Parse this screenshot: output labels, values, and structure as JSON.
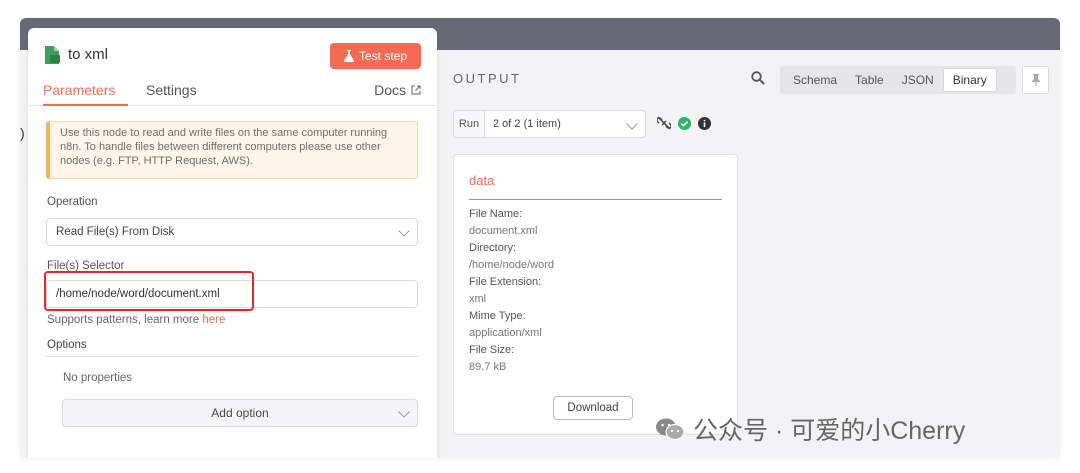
{
  "node": {
    "title": "to xml",
    "test_step_label": "Test step",
    "tabs": [
      {
        "label": "Parameters",
        "active": true
      },
      {
        "label": "Settings",
        "active": false
      }
    ],
    "docs_label": "Docs",
    "notice": "Use this node to read and write files on the same computer running n8n. To handle files between different computers please use other nodes (e.g. FTP, HTTP Request, AWS).",
    "operation": {
      "label": "Operation",
      "value": "Read File(s) From Disk"
    },
    "file_selector": {
      "label": "File(s) Selector",
      "value": "/home/node/word/document.xml"
    },
    "hint_text": "Supports patterns, learn more ",
    "hint_link": "here",
    "options": {
      "label": "Options",
      "empty_text": "No properties",
      "add_label": "Add option"
    }
  },
  "output": {
    "title": "OUTPUT",
    "view_modes": [
      {
        "label": "Schema",
        "active": false
      },
      {
        "label": "Table",
        "active": false
      },
      {
        "label": "JSON",
        "active": false
      },
      {
        "label": "Binary",
        "active": true
      }
    ],
    "run": {
      "label": "Run",
      "value": "2 of 2 (1 item)"
    },
    "card": {
      "title": "data",
      "fields": [
        {
          "label": "File Name:",
          "value": "document.xml"
        },
        {
          "label": "Directory:",
          "value": "/home/node/word"
        },
        {
          "label": "File Extension:",
          "value": "xml"
        },
        {
          "label": "Mime Type:",
          "value": "application/xml"
        },
        {
          "label": "File Size:",
          "value": "89.7 kB"
        }
      ],
      "download_label": "Download"
    }
  },
  "watermark": "公众号 · 可爱的小Cherry",
  "colors": {
    "accent": "#f46a55",
    "success": "#2fb567",
    "highlight": "#e5262b",
    "topbar": "#676a74"
  },
  "icons": [
    "file-xml-icon",
    "flask-icon",
    "external-link-icon",
    "search-icon",
    "pin-icon",
    "unlink-icon",
    "check-circle-icon",
    "info-icon",
    "wechat-icon"
  ]
}
